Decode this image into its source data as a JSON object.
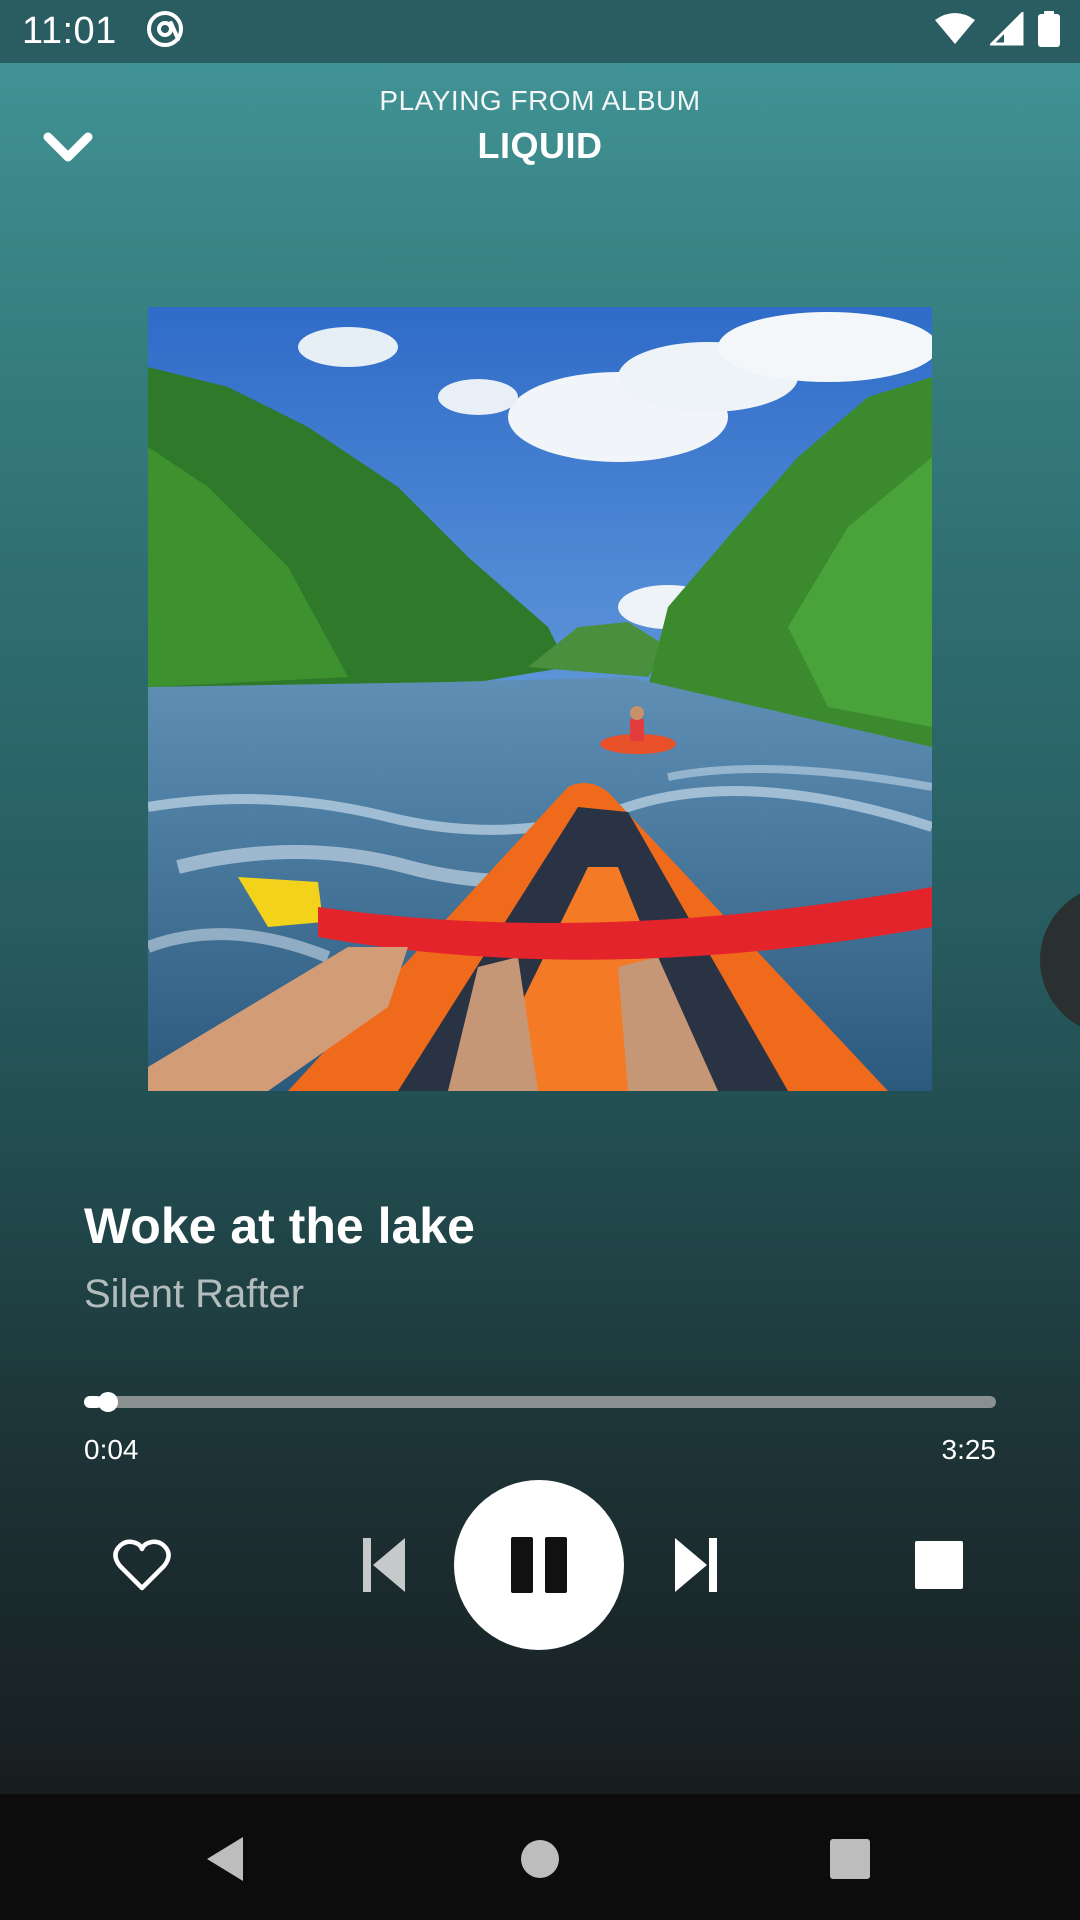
{
  "status_bar": {
    "time": "11:01",
    "icons": [
      "at-sign-icon",
      "wifi-icon",
      "signal-icon",
      "battery-icon"
    ]
  },
  "header": {
    "subtitle": "PLAYING FROM ALBUM",
    "title": "LIQUID",
    "collapse_icon": "chevron-down-icon"
  },
  "album_art": {
    "subject": "rafting photo: kayak on a river with trees and blue sky"
  },
  "track": {
    "title": "Woke at the lake",
    "artist": "Silent Rafter"
  },
  "playback": {
    "current_time": "0:04",
    "total_time": "3:25",
    "progress_fraction": 0.02,
    "state": "playing"
  },
  "controls": {
    "like_icon": "heart-outline-icon",
    "prev_icon": "skip-previous-icon",
    "play_pause_icon": "pause-icon",
    "next_icon": "skip-next-icon",
    "stop_icon": "stop-icon"
  },
  "nav_bar": {
    "icons": [
      "back-icon",
      "home-icon",
      "recents-icon"
    ]
  },
  "colors": {
    "gradient_top": "#43989a",
    "gradient_bottom": "#141617",
    "status_bar": "#2a5d61",
    "artist_text": "#b3bcbd",
    "progress_track": "#8a8f90"
  }
}
